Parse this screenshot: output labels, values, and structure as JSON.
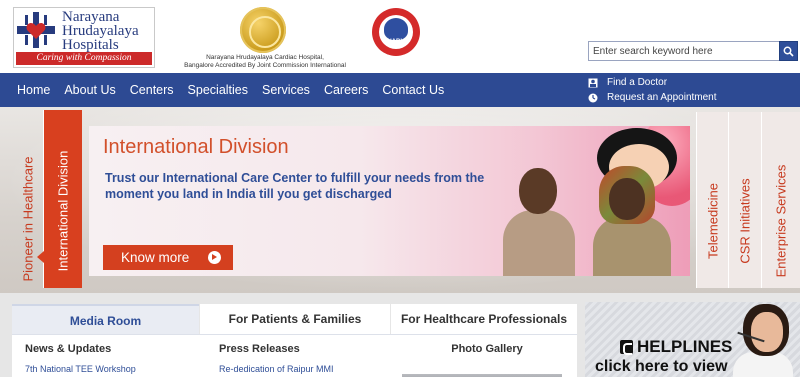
{
  "header": {
    "logo": {
      "name_lines": [
        "Narayana",
        "Hrudayalaya",
        "Hospitals"
      ],
      "tagline": "Caring with Compassion"
    },
    "accreditation_lines": [
      "Narayana Hrudayalaya Cardiac Hospital,",
      "Bangalore Accredited By Joint Commission International"
    ],
    "nabh_label": "NABH",
    "search": {
      "placeholder": "Enter search keyword here"
    }
  },
  "nav": {
    "items": [
      {
        "label": "Home"
      },
      {
        "label": "About Us"
      },
      {
        "label": "Centers"
      },
      {
        "label": "Specialties"
      },
      {
        "label": "Services"
      },
      {
        "label": "Careers"
      },
      {
        "label": "Contact Us"
      }
    ],
    "quick_links": [
      {
        "label": "Find a Doctor",
        "icon": "doctor-icon"
      },
      {
        "label": "Request an Appointment",
        "icon": "clock-icon"
      }
    ]
  },
  "banner": {
    "left_tabs": [
      "Pioneer in Healthcare",
      "International Division"
    ],
    "right_tabs": [
      "Telemedicine",
      "CSR Initiatives",
      "Enterprise Services"
    ],
    "slide": {
      "title": "International Division",
      "subtitle": "Trust our International Care Center to fulfill your needs from the moment you land in India till you get discharged",
      "button": "Know more"
    }
  },
  "info": {
    "tabs": [
      "Media Room",
      "For Patients & Families",
      "For Healthcare Professionals"
    ],
    "columns": {
      "news": {
        "heading": "News & Updates",
        "item": "7th National TEE Workshop"
      },
      "press": {
        "heading": "Press Releases",
        "item": "Re-dedication of Raipur MMI"
      },
      "photo": {
        "heading": "Photo Gallery"
      }
    }
  },
  "helpline": {
    "title": "HELPLINES",
    "cta": "click here to view"
  },
  "colors": {
    "brand_blue": "#2d4a93",
    "accent_orange": "#d4401f",
    "brand_red": "#cc2a2a"
  }
}
